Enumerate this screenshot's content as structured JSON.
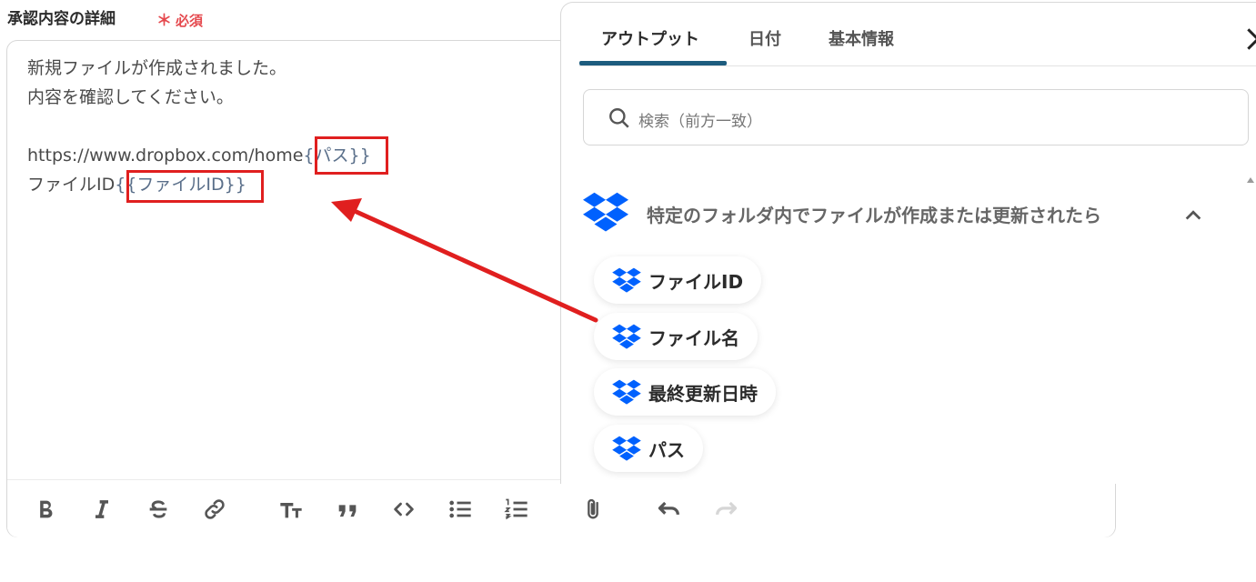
{
  "field": {
    "label": "承認内容の詳細",
    "required_star": "＊",
    "required_text": "必須"
  },
  "editor": {
    "lines": [
      "新規ファイルが作成されました。",
      "内容を確認してください。",
      "",
      "https://www.dropbox.com/home",
      "ファイルID"
    ],
    "var_path": "{パス}}",
    "var_fileid": "{{ファイルID}}"
  },
  "panel": {
    "tabs": [
      "アウトプット",
      "日付",
      "基本情報"
    ],
    "active_tab": 0,
    "search_placeholder": "検索（前方一致）",
    "group_title": "特定のフォルダ内でファイルが作成または更新されたら",
    "outputs": [
      "ファイルID",
      "ファイル名",
      "最終更新日時",
      "パス"
    ]
  },
  "colors": {
    "highlight": "#e01f1f",
    "dropbox": "#0061fe",
    "tab_underline": "#1d5c7e",
    "required": "#e5484d"
  },
  "icons": [
    "close-icon",
    "search-icon",
    "dropbox-icon",
    "chevron-up-icon",
    "bold-icon",
    "italic-icon",
    "strikethrough-icon",
    "link-icon",
    "text-size-icon",
    "quote-icon",
    "code-icon",
    "bullet-list-icon",
    "numbered-list-icon",
    "attachment-icon",
    "undo-icon",
    "redo-icon"
  ]
}
